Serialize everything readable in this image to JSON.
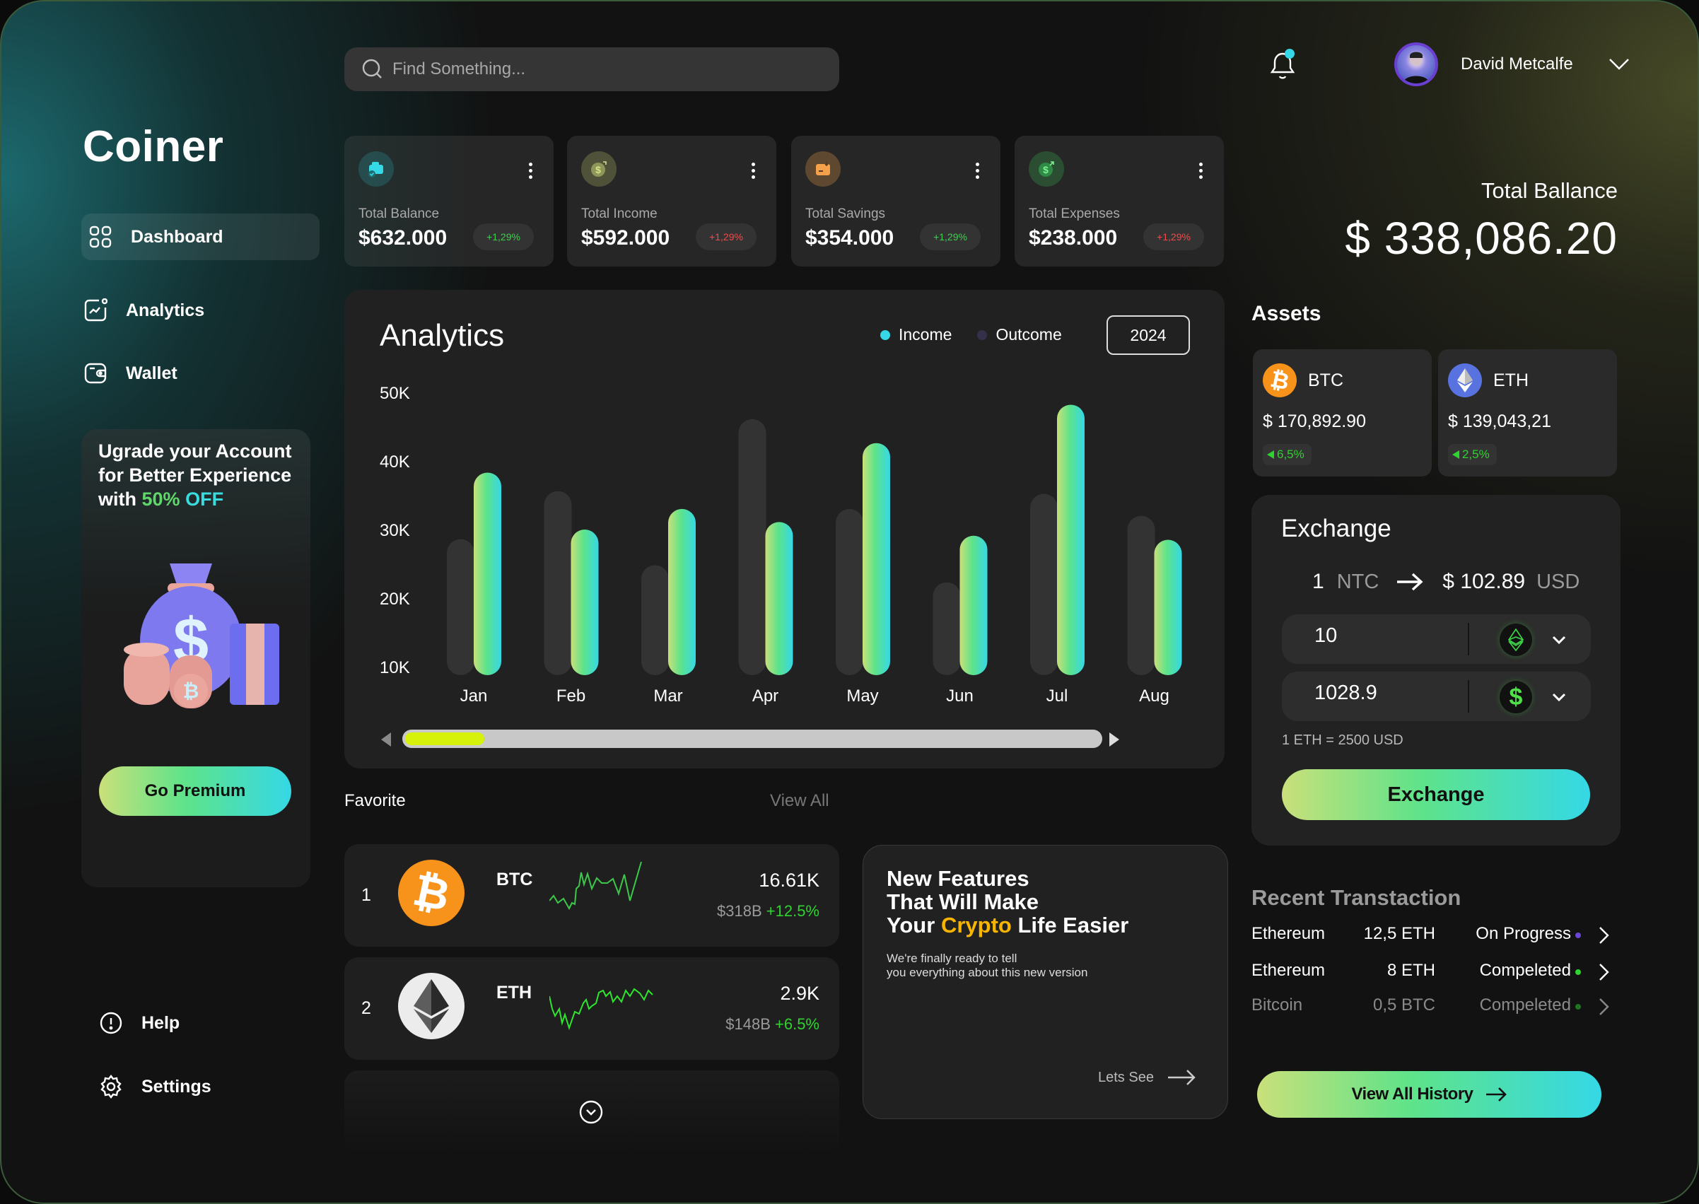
{
  "app": {
    "title": "Coiner"
  },
  "search": {
    "placeholder": "Find Something..."
  },
  "sidebar": {
    "items": [
      {
        "label": "Dashboard",
        "icon": "grid-icon",
        "active": true
      },
      {
        "label": "Analytics",
        "icon": "chart-icon",
        "active": false
      },
      {
        "label": "Wallet",
        "icon": "wallet-icon",
        "active": false
      }
    ],
    "promo": {
      "line1": "Ugrade your Account",
      "line2": "for Better Experience",
      "with": "with",
      "pct": "50%",
      "off": "OFF",
      "button": "Go Premium"
    },
    "bottom": [
      {
        "label": "Help",
        "icon": "help-icon"
      },
      {
        "label": "Settings",
        "icon": "gear-icon"
      }
    ]
  },
  "header": {
    "user_name": "David Metcalfe",
    "notification_icon": "bell-icon"
  },
  "stats": [
    {
      "label": "Total Balance",
      "value": "$632.000",
      "change": "+1,29%",
      "trend": "positive",
      "icon": "wallet-check-icon",
      "icon_color": "#35d8e6"
    },
    {
      "label": "Total Income",
      "value": "$592.000",
      "change": "+1,29%",
      "trend": "negative",
      "icon": "money-bag-icon",
      "icon_color": "#b9c46a"
    },
    {
      "label": "Total Savings",
      "value": "$354.000",
      "change": "+1,29%",
      "trend": "positive",
      "icon": "savings-box-icon",
      "icon_color": "#f5a04a"
    },
    {
      "label": "Total Expenses",
      "value": "$238.000",
      "change": "+1,29%",
      "trend": "negative",
      "icon": "expense-coin-icon",
      "icon_color": "#3cc95a"
    }
  ],
  "analytics": {
    "title": "Analytics",
    "year": "2024",
    "scroll_position": 0.1
  },
  "chart_data": {
    "type": "bar",
    "title": "Analytics",
    "categories": [
      "Jan",
      "Feb",
      "Mar",
      "Apr",
      "May",
      "Jun",
      "Jul",
      "Aug"
    ],
    "series": [
      {
        "name": "Outcome",
        "color": "#333333",
        "values": [
          28.6,
          35.6,
          24.8,
          46.1,
          33.0,
          22.3,
          35.2,
          32.0
        ]
      },
      {
        "name": "Income",
        "color": "#35d8e6",
        "values": [
          38.3,
          30.0,
          33.0,
          31.1,
          42.6,
          29.1,
          48.2,
          28.5
        ]
      }
    ],
    "yticks": [
      "50K",
      "40K",
      "30K",
      "20K",
      "10K"
    ],
    "ytick_values": [
      50,
      40,
      30,
      20,
      10
    ],
    "ylim": [
      8.9,
      50
    ],
    "yunit": "K",
    "legend": [
      {
        "name": "Income",
        "color": "#35d8e6"
      },
      {
        "name": "Outcome",
        "color": "#34304a"
      }
    ],
    "legend_position": "top-right",
    "grid": false
  },
  "favorites": {
    "title": "Favorite",
    "view_all": "View All",
    "items": [
      {
        "rank": "1",
        "symbol": "BTC",
        "price": "16.61K",
        "market_cap": "$318B",
        "change": "+12.5%"
      },
      {
        "rank": "2",
        "symbol": "ETH",
        "price": "2.9K",
        "market_cap": "$148B",
        "change": "+6.5%"
      }
    ]
  },
  "features": {
    "line1": "New Features",
    "line2": "That Will Make",
    "line3_pre": "Your",
    "line3_highlight": "Crypto",
    "line3_post": "Life Easier",
    "sub1": "We're finally ready to tell",
    "sub2": "you everything about this new version",
    "cta": "Lets See"
  },
  "balance": {
    "label": "Total Ballance",
    "value": "$ 338,086.20"
  },
  "assets": {
    "title": "Assets",
    "items": [
      {
        "symbol": "BTC",
        "value": "$ 170,892.90",
        "change": "6,5%"
      },
      {
        "symbol": "ETH",
        "value": "$ 139,043,21",
        "change": "2,5%"
      }
    ]
  },
  "exchange": {
    "title": "Exchange",
    "rate_qty": "1",
    "rate_from": "NTC",
    "rate_value": "$ 102.89",
    "rate_to": "USD",
    "from_value": "10",
    "to_value": "1028.9",
    "note": "1 ETH = 2500 USD",
    "button": "Exchange"
  },
  "recent": {
    "title": "Recent Transtaction",
    "rows": [
      {
        "coin": "Ethereum",
        "amount": "12,5 ETH",
        "status": "On Progress",
        "status_color": "#6b46d6"
      },
      {
        "coin": "Ethereum",
        "amount": "8 ETH",
        "status": "Compeleted",
        "status_color": "#2fd32f"
      },
      {
        "coin": "Bitcoin",
        "amount": "0,5 BTC",
        "status": "Compeleted",
        "status_color": "#2fd32f"
      }
    ],
    "button": "View All History"
  }
}
